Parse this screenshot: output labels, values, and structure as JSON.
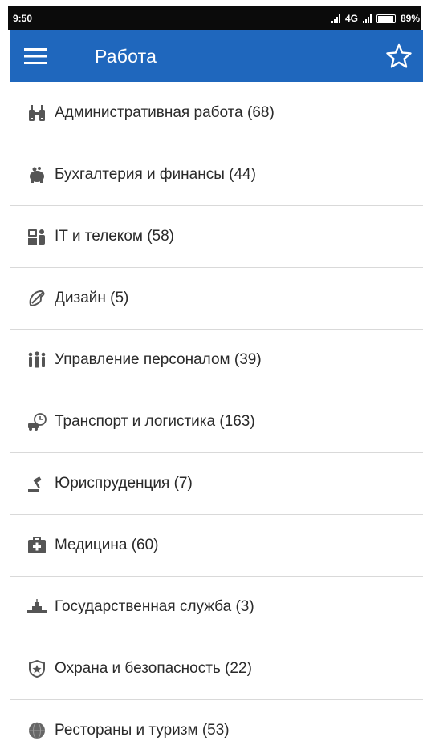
{
  "status_bar": {
    "time": "9:50",
    "network": "4G",
    "battery": "89%"
  },
  "app_bar": {
    "title": "Работа"
  },
  "categories": [
    {
      "label": "Административная работа (68)",
      "icon": "binoculars-icon"
    },
    {
      "label": "Бухгалтерия и финансы (44)",
      "icon": "piggy-bank-icon"
    },
    {
      "label": "IT и телеком (58)",
      "icon": "computer-user-icon"
    },
    {
      "label": "Дизайн (5)",
      "icon": "palette-icon"
    },
    {
      "label": "Управление персоналом (39)",
      "icon": "people-group-icon"
    },
    {
      "label": "Транспорт и логистика (163)",
      "icon": "truck-clock-icon"
    },
    {
      "label": "Юриспруденция (7)",
      "icon": "gavel-icon"
    },
    {
      "label": "Медицина (60)",
      "icon": "first-aid-kit-icon"
    },
    {
      "label": "Государственная служба (3)",
      "icon": "government-building-icon"
    },
    {
      "label": "Охрана и безопасность (22)",
      "icon": "security-badge-icon"
    },
    {
      "label": "Рестораны и туризм (53)",
      "icon": "globe-icon"
    }
  ],
  "colors": {
    "app_bar": "#1f67bd",
    "status_bar": "#0b0b0b",
    "divider": "#d9d9d9",
    "icon": "#555555",
    "text": "#2a2a2a"
  }
}
